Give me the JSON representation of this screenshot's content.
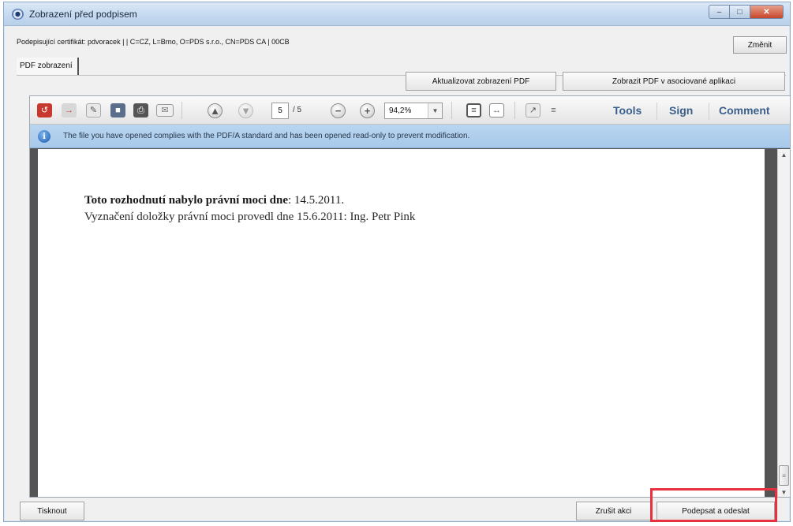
{
  "window": {
    "title": "Zobrazení před podpisem"
  },
  "header": {
    "certificate_text": "Podepisující certifikát: pdvoracek | | C=CZ, L=Brno, O=PDS s.r.o., CN=PDS CA | 00CB",
    "change_label": "Změnit",
    "tab_label": "PDF zobrazení"
  },
  "actions": {
    "refresh_label": "Aktualizovat zobrazení PDF",
    "open_external_label": "Zobrazit PDF v asociované aplikaci"
  },
  "pdf_toolbar": {
    "current_page": "5",
    "page_total": "/ 5",
    "zoom": "94,2%",
    "tools_label": "Tools",
    "sign_label": "Sign",
    "comment_label": "Comment",
    "more_glyph": "≡"
  },
  "infobar": {
    "message": "The file you have opened complies with the PDF/A standard and has been opened read-only to prevent modification."
  },
  "document": {
    "line1_bold": "Toto rozhodnutí nabylo právní moci dne",
    "line1_rest": ": 14.5.2011.",
    "line2": "Vyznačení doložky právní moci provedl dne 15.6.2011: Ing. Petr Pink"
  },
  "footer": {
    "print_label": "Tisknout",
    "cancel_label": "Zrušit akci",
    "sign_send_label": "Podepsat a odeslat"
  },
  "colors": {
    "highlight": "#e8303f",
    "infobar": "#b9d5f0",
    "panel_link": "#3a5f8b"
  }
}
